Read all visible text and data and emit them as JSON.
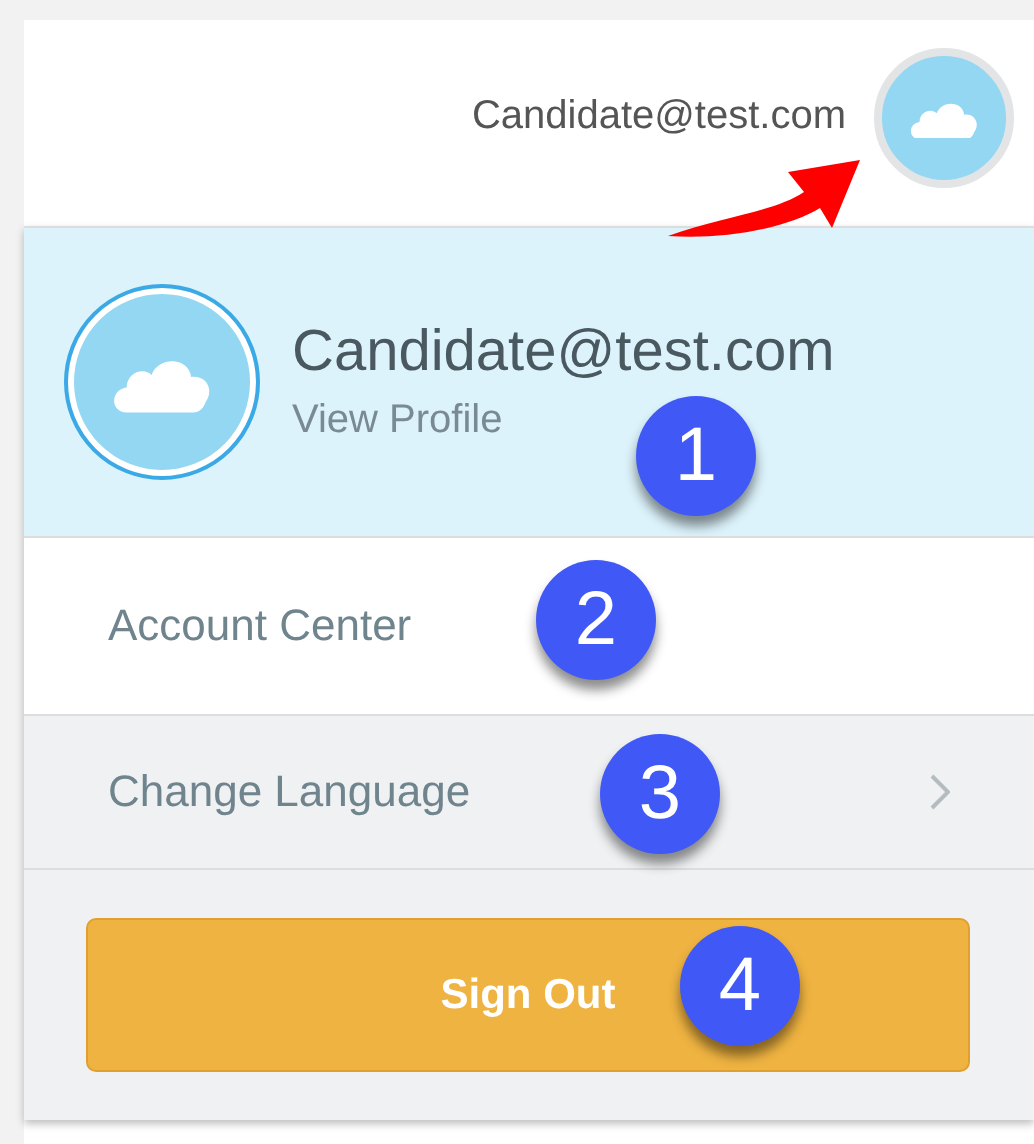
{
  "header": {
    "user_email": "Candidate@test.com"
  },
  "menu": {
    "profile": {
      "email": "Candidate@test.com",
      "link": "View Profile"
    },
    "items": [
      {
        "label": "Account Center",
        "kind": "link"
      },
      {
        "label": "Change Language",
        "kind": "submenu"
      }
    ],
    "sign_out": "Sign Out"
  },
  "callouts": [
    {
      "label": "1"
    },
    {
      "label": "2"
    },
    {
      "label": "3"
    },
    {
      "label": "4"
    }
  ]
}
